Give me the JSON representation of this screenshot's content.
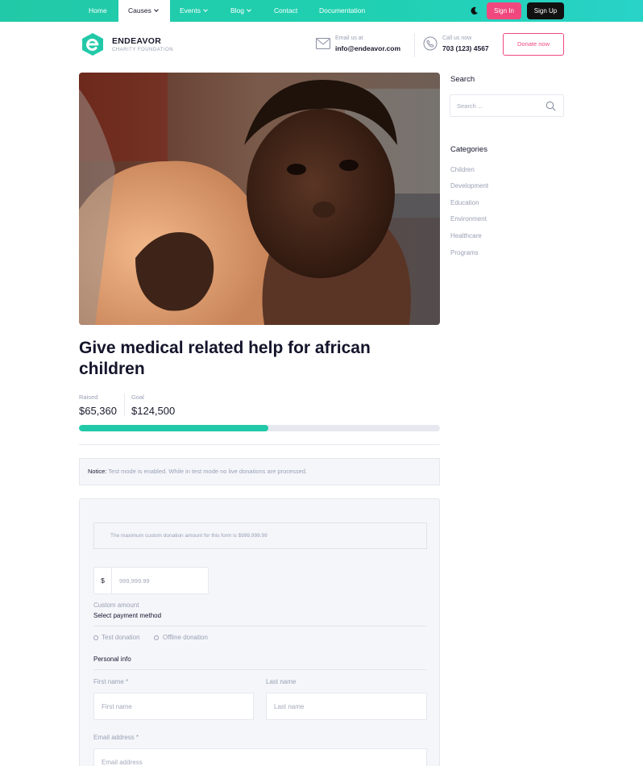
{
  "nav": {
    "items": [
      {
        "label": "Home"
      },
      {
        "label": "Causes"
      },
      {
        "label": "Events"
      },
      {
        "label": "Blog"
      },
      {
        "label": "Contact"
      },
      {
        "label": "Documentation"
      }
    ],
    "sign_in": "Sign In",
    "sign_up": "Sign Up"
  },
  "header": {
    "brand": "ENDEAVOR",
    "brand_sub": "CHARITY FOUNDATION",
    "email_label": "Email us at",
    "email": "info@endeavor.com",
    "call_label": "Call us now",
    "phone": "703 (123) 4567",
    "donate_button": "Donate now"
  },
  "cause": {
    "title": "Give medical related help for african children",
    "raised_label": "Raised",
    "raised": "$65,360",
    "goal_label": "Goal",
    "goal": "$124,500",
    "progress_fraction": 0.525
  },
  "notice": {
    "prefix": "Notice:",
    "text": "Test mode is enabled. While in test mode no live donations are processed."
  },
  "form": {
    "max_note": "The maximum custom donation amount for this form is $999,999.99",
    "currency": "$",
    "amount_placeholder": "999,999.99",
    "custom_amount_label": "Custom amount",
    "payment_heading": "Select payment method",
    "payment_options": [
      "Test donation",
      "Offline donation"
    ],
    "personal_heading": "Personal info",
    "first_name_label": "First name *",
    "last_name_label": "Last name",
    "first_name_placeholder": "First name",
    "last_name_placeholder": "Last name",
    "email_label": "Email address *",
    "email_placeholder": "Email address"
  },
  "sidebar": {
    "search_title": "Search",
    "search_placeholder": "Search ...",
    "categories_title": "Categories",
    "categories": [
      "Children",
      "Development",
      "Education",
      "Environment",
      "Healthcare",
      "Programs"
    ]
  },
  "colors": {
    "accent": "#22c9a8",
    "pink": "#f0487e"
  }
}
